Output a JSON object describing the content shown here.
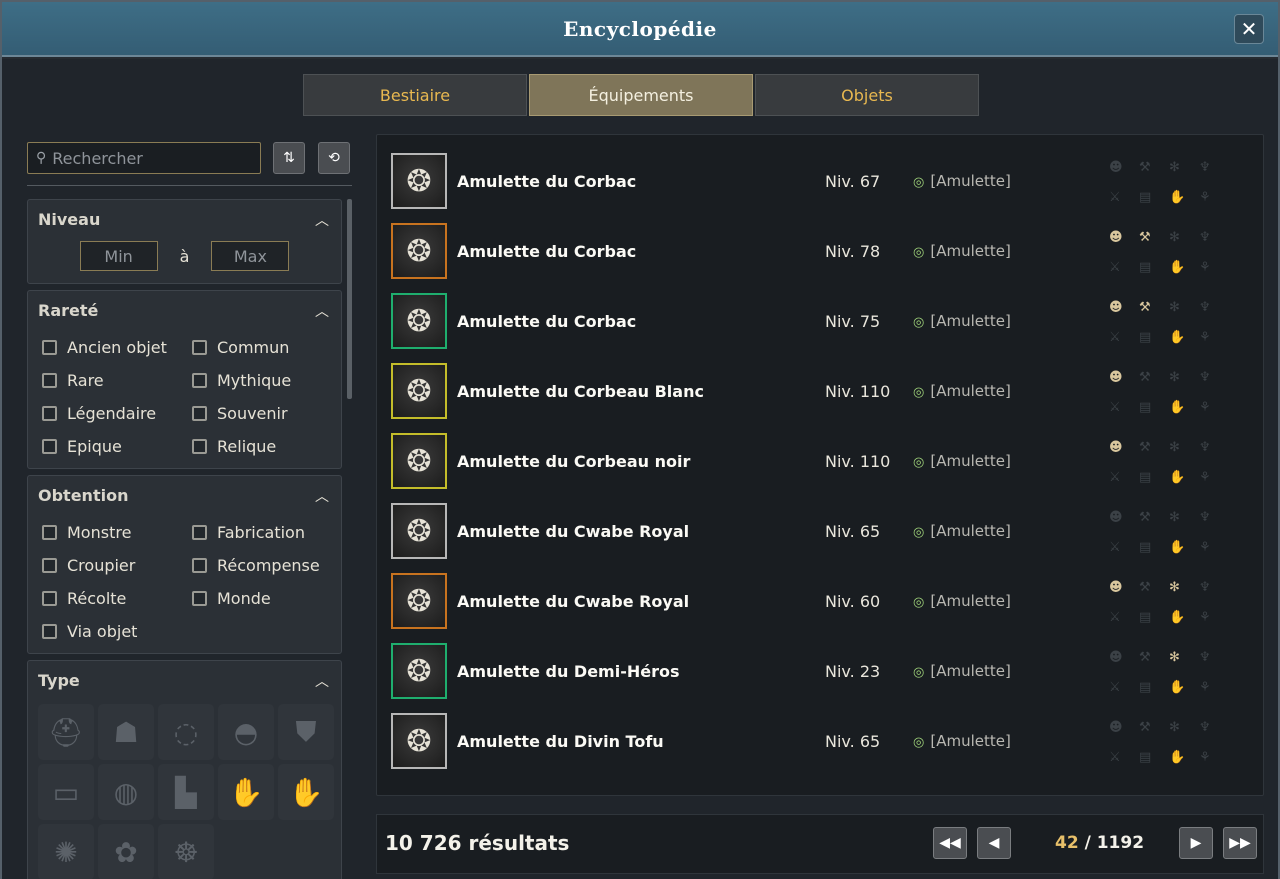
{
  "window": {
    "title": "Encyclopédie",
    "close_label": "✕"
  },
  "tabs": [
    {
      "label": "Bestiaire",
      "active": false
    },
    {
      "label": "Équipements",
      "active": true
    },
    {
      "label": "Objets",
      "active": false
    }
  ],
  "search": {
    "placeholder": "Rechercher",
    "icon": "⚲"
  },
  "toolbar": {
    "sort_icon": "⇅",
    "reset_icon": "⟲"
  },
  "filters": {
    "level": {
      "title": "Niveau",
      "min_placeholder": "Min",
      "between": "à",
      "max_placeholder": "Max"
    },
    "rarity": {
      "title": "Rareté",
      "options": [
        "Ancien objet",
        "Commun",
        "Rare",
        "Mythique",
        "Légendaire",
        "Souvenir",
        "Epique",
        "Relique"
      ]
    },
    "obtention": {
      "title": "Obtention",
      "options": [
        "Monstre",
        "Fabrication",
        "Croupier",
        "Récompense",
        "Récolte",
        "Monde",
        "Via objet"
      ]
    },
    "type": {
      "title": "Type"
    }
  },
  "results": [
    {
      "name": "Amulette du Corbac",
      "level": "Niv. 67",
      "type": "[Amulette]",
      "frame": "#b7b7b7",
      "sources": [
        false,
        false,
        false,
        false,
        false,
        false,
        false,
        false
      ]
    },
    {
      "name": "Amulette du Corbac",
      "level": "Niv. 78",
      "type": "[Amulette]",
      "frame": "#c8731f",
      "sources": [
        true,
        true,
        false,
        false,
        false,
        false,
        false,
        false
      ]
    },
    {
      "name": "Amulette du Corbac",
      "level": "Niv. 75",
      "type": "[Amulette]",
      "frame": "#1fae6e",
      "sources": [
        true,
        true,
        false,
        false,
        false,
        false,
        false,
        false
      ]
    },
    {
      "name": "Amulette du Corbeau Blanc",
      "level": "Niv. 110",
      "type": "[Amulette]",
      "frame": "#c4bd2a",
      "sources": [
        true,
        false,
        false,
        false,
        false,
        false,
        false,
        false
      ]
    },
    {
      "name": "Amulette du Corbeau noir",
      "level": "Niv. 110",
      "type": "[Amulette]",
      "frame": "#c4bd2a",
      "sources": [
        true,
        false,
        false,
        false,
        false,
        false,
        false,
        false
      ]
    },
    {
      "name": "Amulette du Cwabe Royal",
      "level": "Niv. 65",
      "type": "[Amulette]",
      "frame": "#b7b7b7",
      "sources": [
        false,
        false,
        false,
        false,
        false,
        false,
        false,
        false
      ]
    },
    {
      "name": "Amulette du Cwabe Royal",
      "level": "Niv. 60",
      "type": "[Amulette]",
      "frame": "#c8731f",
      "sources": [
        true,
        false,
        true,
        false,
        false,
        false,
        false,
        false
      ]
    },
    {
      "name": "Amulette du Demi-Héros",
      "level": "Niv. 23",
      "type": "[Amulette]",
      "frame": "#1fae6e",
      "sources": [
        false,
        false,
        true,
        false,
        false,
        false,
        false,
        false
      ]
    },
    {
      "name": "Amulette du Divin Tofu",
      "level": "Niv. 65",
      "type": "[Amulette]",
      "frame": "#b7b7b7",
      "sources": [
        false,
        false,
        false,
        false,
        false,
        false,
        false,
        false
      ]
    }
  ],
  "footer": {
    "count": "10 726 résultats",
    "page_current": "42",
    "page_sep": " / ",
    "page_total": "1192"
  },
  "colors": {
    "accent_gold": "#e8b850",
    "title_bar": "#3e6e86"
  }
}
